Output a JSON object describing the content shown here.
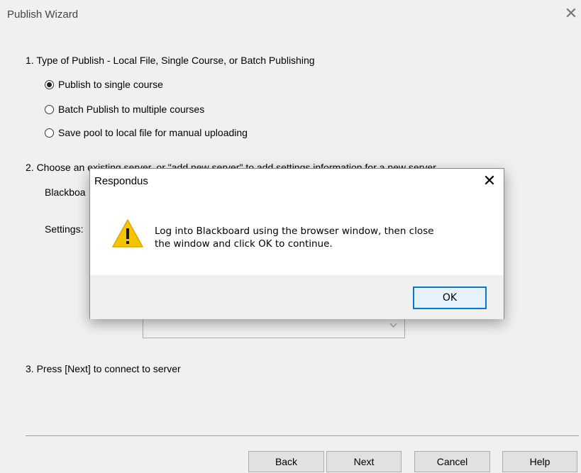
{
  "window": {
    "title": "Publish Wizard",
    "close_glyph": "✕"
  },
  "step1": {
    "label": "1.  Type of Publish - Local File, Single Course, or Batch Publishing",
    "options": [
      {
        "label": "Publish to single course",
        "checked": true
      },
      {
        "label": "Batch Publish to multiple courses",
        "checked": false
      },
      {
        "label": "Save pool to local file for manual uploading",
        "checked": false
      }
    ]
  },
  "step2": {
    "label": "2.  Choose an existing server, or \"add new server\" to add settings information for a new server",
    "blackboard_label": "Blackboa",
    "settings_label": "Settings:"
  },
  "step3": {
    "label": "3.  Press [Next] to connect to server"
  },
  "buttons": {
    "back": "Back",
    "next": "Next",
    "cancel": "Cancel",
    "help": "Help"
  },
  "modal": {
    "title": "Respondus",
    "close_glyph": "✕",
    "icon": "warning-icon",
    "message_line1": "Log into Blackboard using the browser window, then close",
    "message_line2": "the window and click OK to continue.",
    "ok_label": "OK"
  },
  "colors": {
    "accent": "#0078d7",
    "warning": "#f5c400"
  }
}
